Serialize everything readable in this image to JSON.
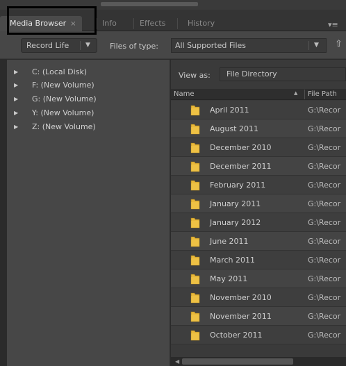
{
  "tabs": [
    {
      "label": "Media Browser",
      "close": "×"
    },
    {
      "label": "Info"
    },
    {
      "label": "Effects"
    },
    {
      "label": "History"
    }
  ],
  "toolbar": {
    "record_label": "Record Life",
    "files_of_type_label": "Files of type:",
    "files_of_type_value": "All Supported Files"
  },
  "tree": [
    {
      "label": "C: (Local Disk)"
    },
    {
      "label": "F: (New Volume)"
    },
    {
      "label": "G: (New Volume)"
    },
    {
      "label": "Y: (New Volume)"
    },
    {
      "label": "Z: (New Volume)"
    }
  ],
  "view": {
    "label": "View as:",
    "value": "File Directory"
  },
  "columns": {
    "name": "Name",
    "path": "File Path"
  },
  "files": [
    {
      "name": "April 2011",
      "path": "G:\\Recor"
    },
    {
      "name": "August 2011",
      "path": "G:\\Recor"
    },
    {
      "name": "December 2010",
      "path": "G:\\Recor"
    },
    {
      "name": "December 2011",
      "path": "G:\\Recor"
    },
    {
      "name": "February 2011",
      "path": "G:\\Recor"
    },
    {
      "name": "January 2011",
      "path": "G:\\Recor"
    },
    {
      "name": "January 2012",
      "path": "G:\\Recor"
    },
    {
      "name": "June 2011",
      "path": "G:\\Recor"
    },
    {
      "name": "March 2011",
      "path": "G:\\Recor"
    },
    {
      "name": "May 2011",
      "path": "G:\\Recor"
    },
    {
      "name": "November 2010",
      "path": "G:\\Recor"
    },
    {
      "name": "November 2011",
      "path": "G:\\Recor"
    },
    {
      "name": "October 2011",
      "path": "G:\\Recor"
    }
  ],
  "colors": {
    "folder": "#e8b83a",
    "panel": "#474747",
    "list": "#3e3e3e"
  }
}
